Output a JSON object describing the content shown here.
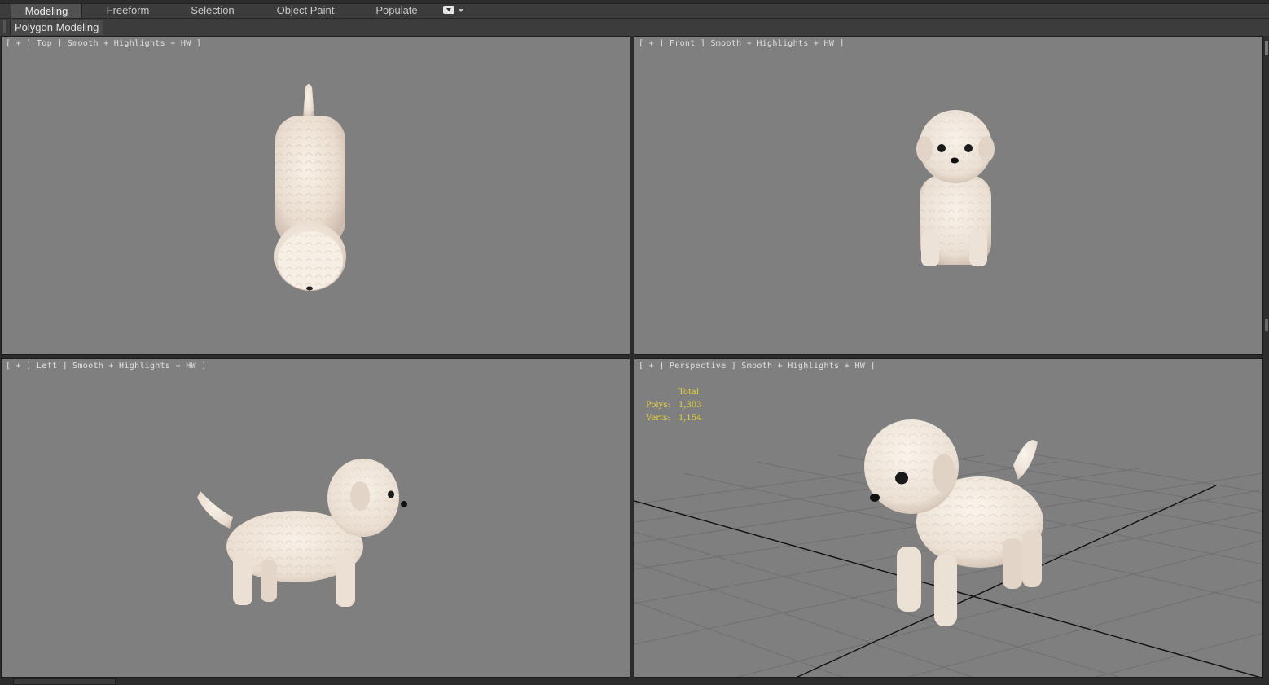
{
  "ribbon": {
    "tabs": [
      "Modeling",
      "Freeform",
      "Selection",
      "Object Paint",
      "Populate"
    ],
    "active_tab": "Modeling",
    "panel_label": "Polygon Modeling"
  },
  "viewports": {
    "top": {
      "label": "[ + ] Top ] Smooth + Highlights + HW ]"
    },
    "front": {
      "label": "[ + ] Front ] Smooth + Highlights + HW ]"
    },
    "left": {
      "label": "[ + ] Left ] Smooth + Highlights + HW ]"
    },
    "perspective": {
      "label": "[ + ] Perspective ] Smooth + Highlights + HW ]",
      "stats": {
        "title": "Total",
        "polys_label": "Polys:",
        "polys_value": "1,303",
        "verts_label": "Verts:",
        "verts_value": "1,154"
      }
    }
  },
  "colors": {
    "viewport_bg": "#7f7f7f",
    "stats_text": "#e8d23a",
    "ui_bg": "#3c3c3c",
    "model_fur": "#efe5da"
  },
  "icons": [
    "tab-dropdown-icon",
    "viewport-plus-menu"
  ]
}
